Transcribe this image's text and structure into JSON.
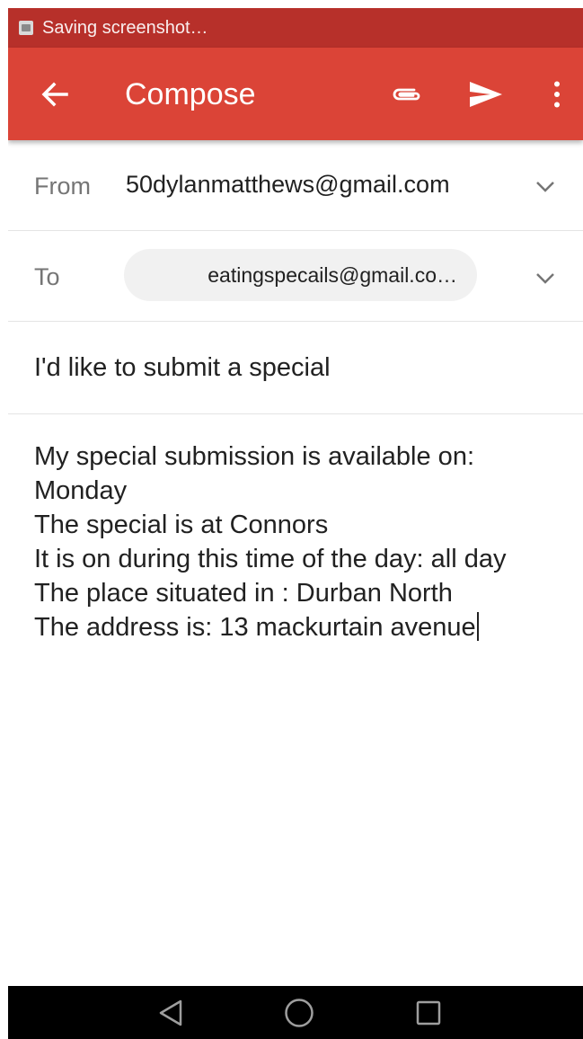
{
  "status_bar": {
    "text": "Saving screenshot…"
  },
  "app_bar": {
    "title": "Compose",
    "icons": [
      "back-arrow-icon",
      "paperclip-icon",
      "send-icon",
      "more-vert-icon"
    ]
  },
  "from": {
    "label": "From",
    "value": "50dylanmatthews@gmail.com"
  },
  "to": {
    "label": "To",
    "chip": "eatingspecails@gmail.co…"
  },
  "subject": {
    "value": "I'd like to submit a special"
  },
  "body": {
    "lines": [
      "My special submission is available on:",
      "Monday",
      "The special is at Connors",
      "It is on during this time of the day: all day",
      "The place situated in : Durban North",
      "The address is: 13 mackurtain avenue"
    ]
  },
  "nav": {
    "icons": [
      "back-triangle-icon",
      "home-circle-icon",
      "recents-square-icon"
    ]
  },
  "colors": {
    "status_bar": "#b7302a",
    "app_bar": "#db4437",
    "chip_bg": "#f1f1f1"
  }
}
